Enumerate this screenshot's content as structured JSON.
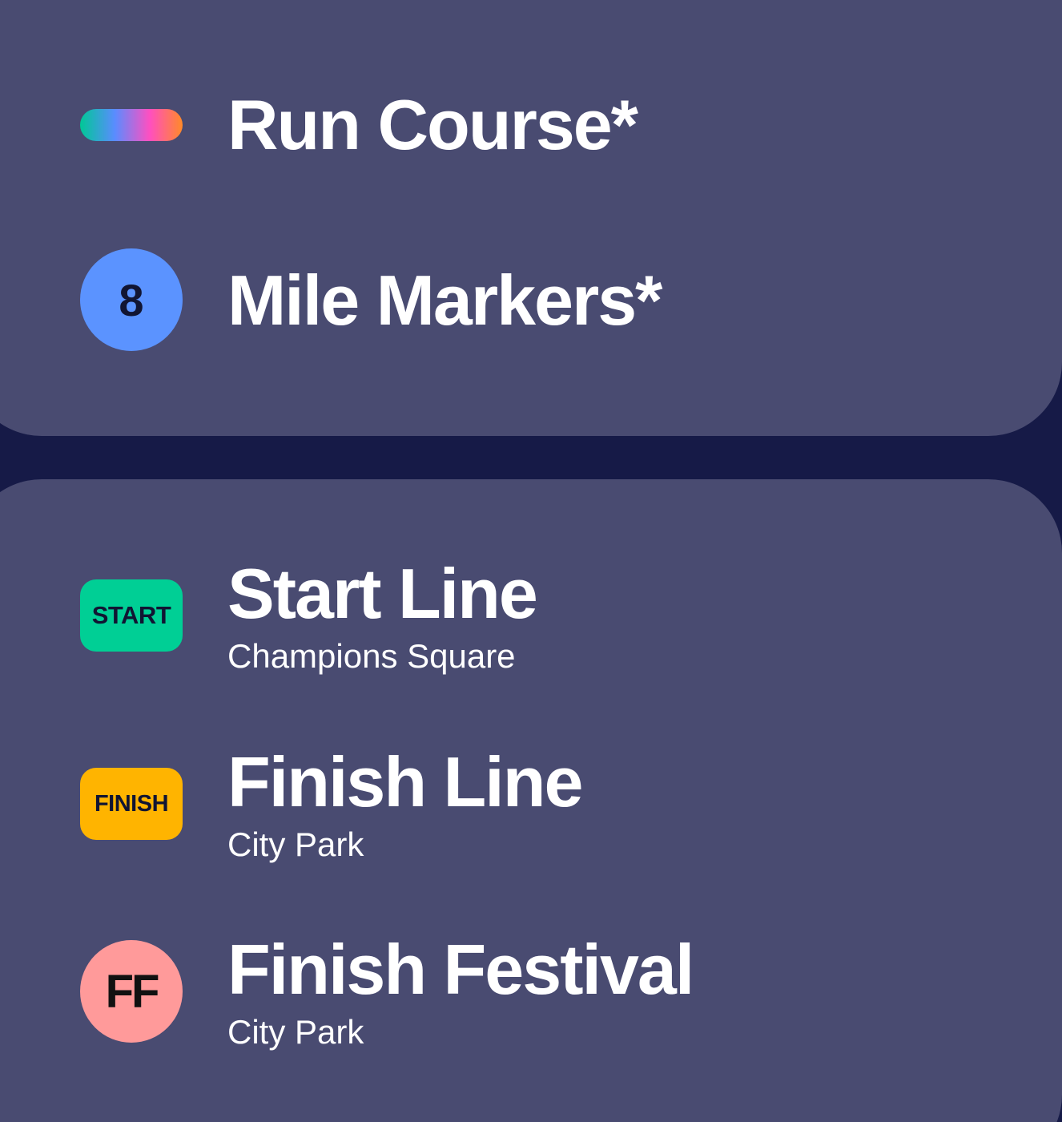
{
  "colors": {
    "background": "#161a47",
    "card": "#494b71",
    "text": "#ffffff",
    "mile_marker": "#5b93ff",
    "start_tag": "#00cf95",
    "finish_tag": "#ffb400",
    "festival_marker": "#ff9a9a",
    "course_gradient": [
      "#00c896",
      "#5a8cff",
      "#ff4fc0",
      "#ff8a28"
    ]
  },
  "legend_top": {
    "run_course": {
      "icon": "gradient-course-icon",
      "title": "Run Course*"
    },
    "mile_markers": {
      "icon_text": "8",
      "title": "Mile Markers*"
    }
  },
  "legend_bottom": {
    "start_line": {
      "icon_text": "START",
      "title": "Start Line",
      "subtitle": "Champions Square"
    },
    "finish_line": {
      "icon_text": "FINISH",
      "title": "Finish Line",
      "subtitle": "City Park"
    },
    "finish_festival": {
      "icon_text": "FF",
      "title": "Finish Festival",
      "subtitle": "City Park"
    }
  }
}
